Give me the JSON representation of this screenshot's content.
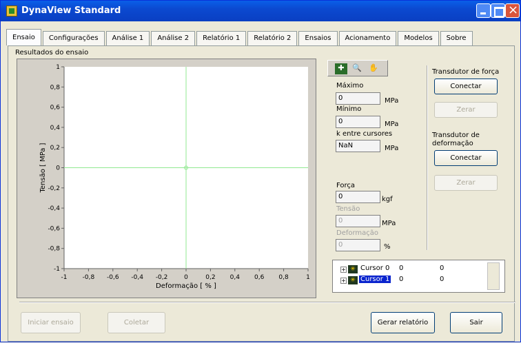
{
  "window": {
    "title": "DynaView Standard"
  },
  "tabs": [
    "Ensaio",
    "Configurações",
    "Análise 1",
    "Análise 2",
    "Relatório 1",
    "Relatório 2",
    "Ensaios",
    "Acionamento",
    "Modelos",
    "Sobre"
  ],
  "section_title": "Resultados do ensaio",
  "chart_data": {
    "type": "line",
    "xlabel": "Deformação [ % ]",
    "ylabel": "Tensão [ MPa ]",
    "xlim": [
      -1,
      1
    ],
    "ylim": [
      -1,
      1
    ],
    "x_ticks": [
      "-1",
      "-0,8",
      "-0,6",
      "-0,4",
      "-0,2",
      "0",
      "0,2",
      "0,4",
      "0,6",
      "0,8",
      "1"
    ],
    "y_ticks": [
      "1",
      "0,8",
      "0,6",
      "0,4",
      "0,2",
      "0",
      "-0,2",
      "-0,4",
      "-0,6",
      "-0,8",
      "-1"
    ],
    "cursor_lines": {
      "x": 0,
      "y": 0
    },
    "series": [],
    "grid": false
  },
  "readouts": {
    "max_label": "Máximo",
    "max_value": "0",
    "max_unit": "MPa",
    "min_label": "Mínimo",
    "min_value": "0",
    "min_unit": "MPa",
    "k_label": "k entre cursores",
    "k_value": "NaN",
    "k_unit": "MPa",
    "forca_label": "Força",
    "forca_value": "0",
    "forca_unit": "kgf",
    "tensao_label": "Tensão",
    "tensao_value": "0",
    "tensao_unit": "MPa",
    "deform_label": "Deformação",
    "deform_value": "0",
    "deform_unit": "%"
  },
  "transducers": {
    "force_label": "Transdutor de força",
    "force_connect": "Conectar",
    "force_zero": "Zerar",
    "deform_label_line1": "Transdutor de",
    "deform_label_line2": "deformação",
    "deform_connect": "Conectar",
    "deform_zero": "Zerar"
  },
  "cursors": [
    {
      "name": "Cursor 0",
      "x": "0",
      "y": "0"
    },
    {
      "name": "Cursor 1",
      "x": "0",
      "y": "0"
    }
  ],
  "bottom_buttons": {
    "start": "Iniciar ensaio",
    "collect": "Coletar",
    "report": "Gerar relatório",
    "exit": "Sair"
  },
  "colors": {
    "cursor_line": "#90e890",
    "title_bar": "#0b49d0"
  }
}
